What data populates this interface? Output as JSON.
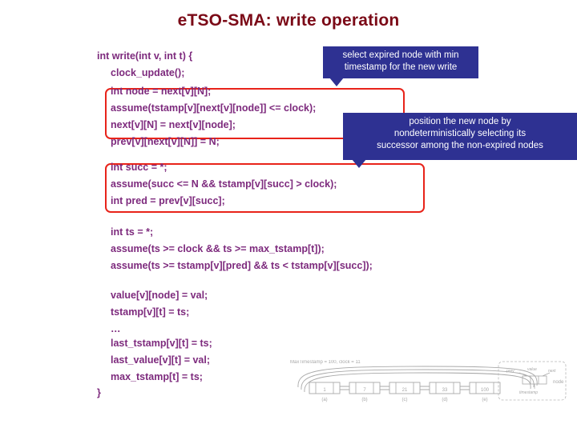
{
  "slide": {
    "title": "eTSO-SMA: write operation",
    "title_color": "#7B0A17",
    "code_color": "#7D2A7D",
    "highlight_color": "#E8231A",
    "callout_color": "#2E3192"
  },
  "code": {
    "lines": [
      {
        "text": "int write(int v, int t) {",
        "indent": 0
      },
      {
        "text": "clock_update();",
        "indent": 1
      },
      {
        "text": "int node = next[v][N];",
        "indent": 1
      },
      {
        "text": "assume(tstamp[v][next[v][node]] <= clock);",
        "indent": 1
      },
      {
        "text": "next[v][N] = next[v][node];",
        "indent": 1
      },
      {
        "text": "prev[v][next[v][N]] = N;",
        "indent": 1
      },
      {
        "text": "int succ = *;",
        "indent": 1
      },
      {
        "text": "assume(succ <= N && tstamp[v][succ] > clock);",
        "indent": 1
      },
      {
        "text": "int pred = prev[v][succ];",
        "indent": 1
      },
      {
        "text": "int ts = *;",
        "indent": 1
      },
      {
        "text": "assume(ts >= clock && ts >= max_tstamp[t]);",
        "indent": 1
      },
      {
        "text": "assume(ts >= tstamp[v][pred] && ts < tstamp[v][succ]);",
        "indent": 1
      },
      {
        "text": "value[v][node] = val;",
        "indent": 1
      },
      {
        "text": "tstamp[v][t] = ts;",
        "indent": 1
      },
      {
        "text": "…",
        "indent": 1
      },
      {
        "text": "last_tstamp[v][t] = ts;",
        "indent": 1
      },
      {
        "text": "last_value[v][t] = val;",
        "indent": 1
      },
      {
        "text": "max_tstamp[t] = ts;",
        "indent": 1
      },
      {
        "text": "}",
        "indent": 0
      }
    ]
  },
  "callouts": [
    {
      "name": "callout-select-expired-node",
      "lines": [
        "select expired node with min",
        "timestamp for the new write"
      ]
    },
    {
      "name": "callout-position-new-node",
      "lines": [
        "position the new node by",
        "nondeterministically selecting its",
        "successor among the non-expired nodes"
      ]
    }
  ],
  "diagram": {
    "header": "MaxTimestamp = 100,    clock = 11",
    "nodes": [
      {
        "value": "1",
        "label": "(a)"
      },
      {
        "value": "7",
        "label": "(b)"
      },
      {
        "value": "21",
        "label": "(c)"
      },
      {
        "value": "33",
        "label": "(d)"
      },
      {
        "value": "100",
        "label": "(e)"
      }
    ],
    "legend": {
      "prev": "prev",
      "value": "value",
      "next": "next",
      "timestamp": "timestamp",
      "node": "node"
    }
  }
}
